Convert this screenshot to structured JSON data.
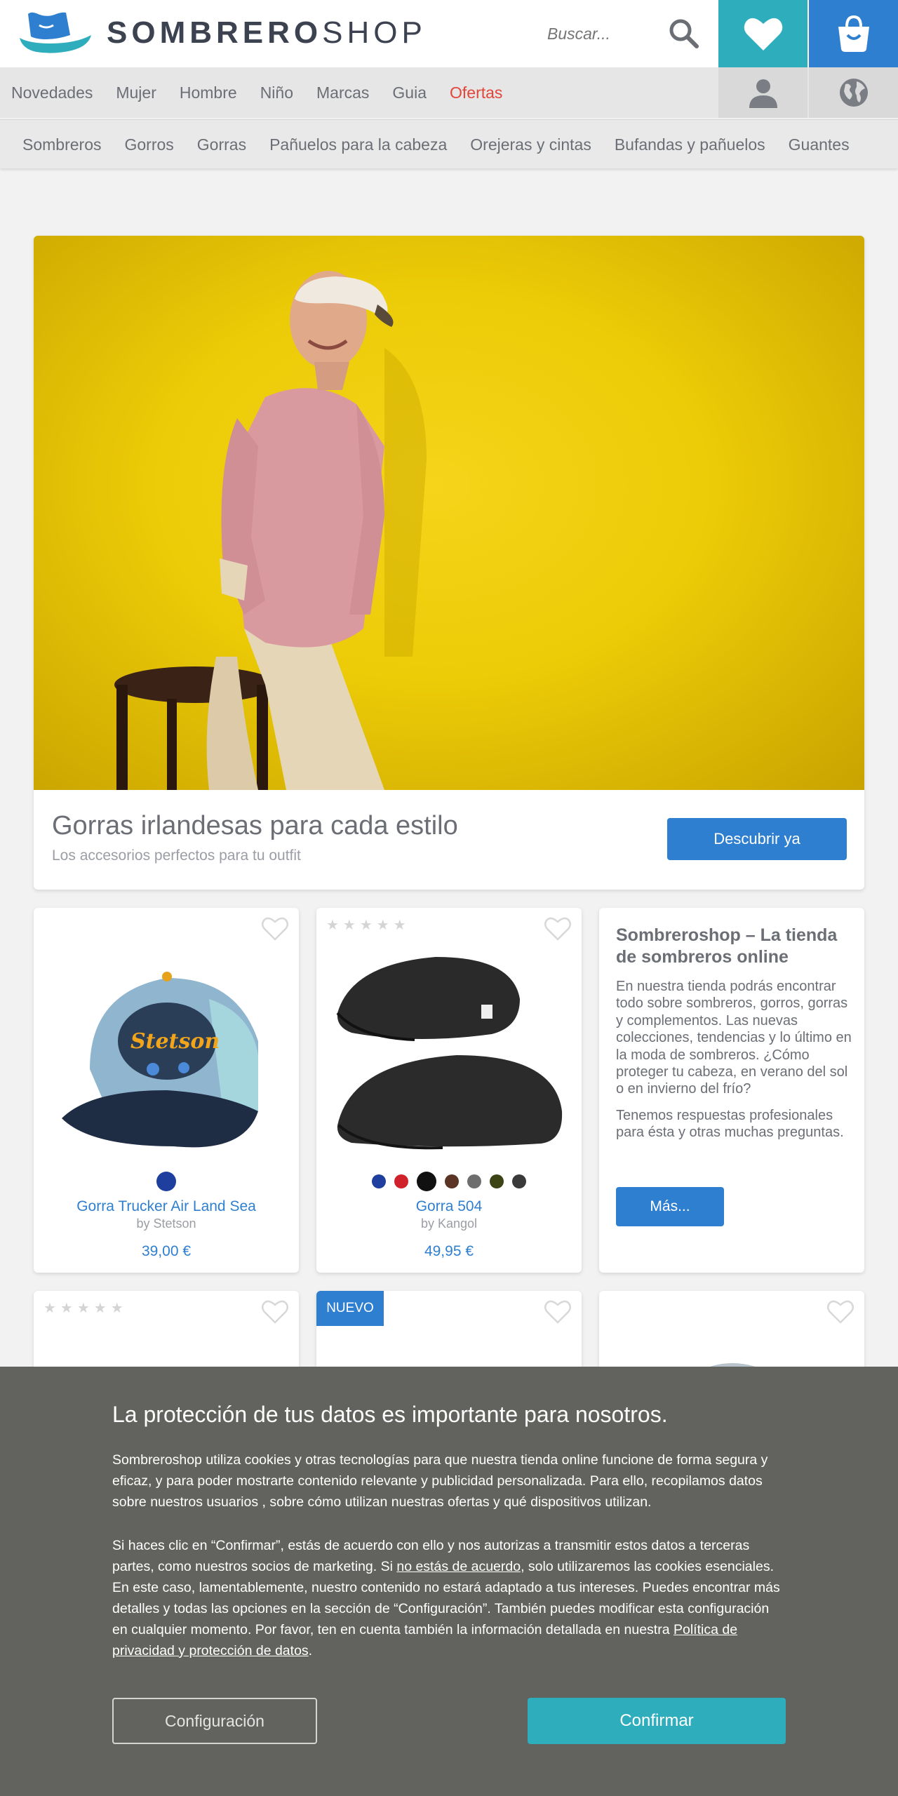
{
  "header": {
    "logo_bold": "SOMBRERO",
    "logo_light": "SHOP",
    "search_placeholder": "Buscar...",
    "icons": [
      "hat-logo-icon",
      "search-icon",
      "heart-icon",
      "shopping-bag-icon",
      "user-icon",
      "globe-icon"
    ]
  },
  "nav": {
    "items": [
      "Novedades",
      "Mujer",
      "Hombre",
      "Niño",
      "Marcas",
      "Guia",
      "Ofertas"
    ],
    "sale_color": "#e2463a"
  },
  "subnav": {
    "items": [
      "Sombreros",
      "Gorros",
      "Gorras",
      "Pañuelos para la cabeza",
      "Orejeras y cintas",
      "Bufandas y pañuelos",
      "Guantes"
    ]
  },
  "hero": {
    "title": "Gorras irlandesas para cada estilo",
    "subtitle": "Los accesorios perfectos para tu outfit",
    "button": "Descubrir ya"
  },
  "products": [
    {
      "name": "Gorra Trucker Air Land Sea",
      "brand": "by Stetson",
      "price": "39,00 €",
      "cap_print": "Stetson",
      "colors": [
        "#1f3f9e"
      ]
    },
    {
      "name": "Gorra 504",
      "brand": "by Kangol",
      "price": "49,95 €",
      "stars": "★★★★★",
      "colors": [
        "#1f3f9e",
        "#d0202a",
        "#111111",
        "#5a3424",
        "#6e6e6e",
        "#3c4416",
        "#3a3a3a"
      ]
    }
  ],
  "info": {
    "title": "Sombreroshop – La tienda de sombreros online",
    "p1": "En nuestra tienda podrás encontrar todo sobre sombreros, gorros, gorras y complementos. Las nuevas colecciones, tendencias y lo último en la moda de sombreros. ¿Cómo proteger tu cabeza, en verano del sol o en invierno del frío?",
    "p2": "Tenemos respuestas profesionales para ésta y otras muchas preguntas.",
    "button": "Más..."
  },
  "row2": {
    "stars": "★★★★★",
    "badge": "NUEVO"
  },
  "cookie": {
    "title": "La protección de tus datos es importante para nosotros.",
    "p1": "Sombreroshop utiliza cookies y otras tecnologías para que nuestra tienda online funcione de forma segura y eficaz, y para poder mostrarte contenido relevante y publicidad personalizada. Para ello, recopilamos datos sobre nuestros usuarios , sobre cómo utilizan nuestras ofertas y qué dispositivos utilizan.",
    "p2_a": "Si haces clic en “Confirmar”, estás de acuerdo con ello y nos autorizas a transmitir estos datos a terceras partes, como nuestros socios de marketing. Si ",
    "p2_link1": "no estás de acuerdo",
    "p2_b": ", solo utilizaremos las cookies esenciales. En este caso, lamentablemente, nuestro contenido no estará adaptado a tus intereses. Puedes encontrar más detalles y todas las opciones en la sección de “Configuración”. También puedes modificar esta configuración en cualquier momento. Por favor, ten en cuenta también la información detallada en nuestra ",
    "p2_link2": "Política de privacidad y protección de datos",
    "p2_c": ".",
    "config_button": "Configuración",
    "confirm_button": "Confirmar"
  },
  "colors": {
    "teal": "#2eaebc",
    "blue": "#2f7fd1",
    "overlay": "#62635e",
    "hero_bg": "#eccb07"
  }
}
